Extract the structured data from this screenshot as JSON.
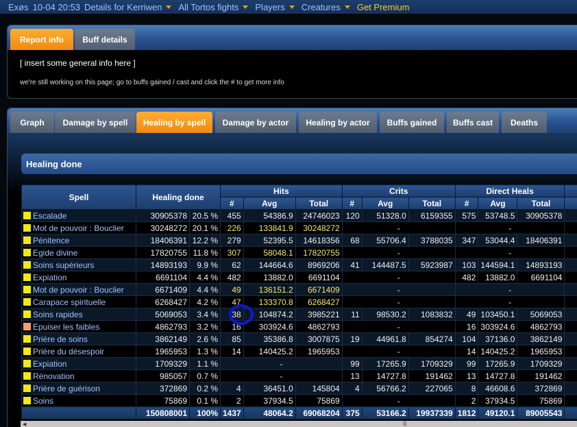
{
  "nav": {
    "items": [
      "Exøs",
      "10-04 20:53",
      "Details for Kerriwen",
      "All Tortos fights",
      "Players",
      "Creatures"
    ],
    "premium": "Get Premium"
  },
  "report_tabs": [
    "Report info",
    "Buff details"
  ],
  "report_info": {
    "text": "[ insert some general info here ]",
    "note": "we're still working on this page; go to buffs gained / cast and click the # to get more info"
  },
  "main_tabs": [
    "Graph",
    "Damage by spell",
    "Healing by spell",
    "Damage by actor",
    "Healing by actor",
    "Buffs gained",
    "Buffs cast",
    "Deaths"
  ],
  "active_tab": "Healing by spell",
  "section_title": "Healing done",
  "table": {
    "headers": {
      "spell": "Spell",
      "healing_done": "Healing done",
      "hits": "Hits",
      "crits": "Crits",
      "direct": "Direct Heals",
      "sub": [
        "#",
        "Avg",
        "Total",
        "#",
        "Avg",
        "Total",
        "#",
        "Avg",
        "Total"
      ]
    },
    "rows": [
      {
        "spell": "Escalade",
        "amount": "30905378",
        "pct": "20.5 %",
        "h_n": "455",
        "h_avg": "54386.9",
        "h_tot": "24746023",
        "c_n": "120",
        "c_avg": "51328.0",
        "c_tot": "6159355",
        "d_n": "575",
        "d_avg": "53748.5",
        "d_tot": "30905378"
      },
      {
        "spell": "Mot de pouvoir : Bouclier",
        "amount": "30248272",
        "pct": "20.1 %",
        "h_n": "226",
        "h_avg": "133841.9",
        "h_tot": "30248272",
        "c_dash": "-",
        "d_dash": "-"
      },
      {
        "spell": "Pénitence",
        "amount": "18406391",
        "pct": "12.2 %",
        "h_n": "279",
        "h_avg": "52395.5",
        "h_tot": "14618356",
        "c_n": "68",
        "c_avg": "55706.4",
        "c_tot": "3788035",
        "d_n": "347",
        "d_avg": "53044.4",
        "d_tot": "18406391"
      },
      {
        "spell": "Egide divine",
        "amount": "17820755",
        "pct": "11.8 %",
        "h_n": "307",
        "h_avg": "58048.1",
        "h_tot": "17820755",
        "c_dash": "-",
        "d_dash": "-"
      },
      {
        "spell": "Soins supérieurs",
        "amount": "14893193",
        "pct": "9.9 %",
        "h_n": "62",
        "h_avg": "144664.6",
        "h_tot": "8969206",
        "c_n": "41",
        "c_avg": "144487.5",
        "c_tot": "5923987",
        "d_n": "103",
        "d_avg": "144594.1",
        "d_tot": "14893193"
      },
      {
        "spell": "Expiation",
        "amount": "6691104",
        "pct": "4.4 %",
        "h_n": "482",
        "h_avg": "13882.0",
        "h_tot": "6691104",
        "c_dash": "-",
        "d_n": "482",
        "d_avg": "13882.0",
        "d_tot": "6691104"
      },
      {
        "spell": "Mot de pouvoir : Bouclier",
        "amount": "6671409",
        "pct": "4.4 %",
        "h_n": "49",
        "h_avg": "136151.2",
        "h_tot": "6671409",
        "c_dash": "-",
        "d_dash": "-"
      },
      {
        "spell": "Carapace spirituelle",
        "amount": "6268427",
        "pct": "4.2 %",
        "h_n": "47",
        "h_avg": "133370.8",
        "h_tot": "6268427",
        "c_dash": "-",
        "d_dash": "-"
      },
      {
        "spell": "Soins rapides",
        "amount": "5069053",
        "pct": "3.4 %",
        "h_n": "38",
        "h_avg": "104874.2",
        "h_tot": "3985221",
        "c_n": "11",
        "c_avg": "98530.2",
        "c_tot": "1083832",
        "d_n": "49",
        "d_avg": "103450.1",
        "d_tot": "5069053"
      },
      {
        "spell": "Epuiser les faibles",
        "amount": "4862793",
        "pct": "3.2 %",
        "h_n": "16",
        "h_avg": "303924.6",
        "h_tot": "4862793",
        "c_dash": "-",
        "d_n": "16",
        "d_avg": "303924.6",
        "d_tot": "4862793"
      },
      {
        "spell": "Prière de soins",
        "amount": "3862149",
        "pct": "2.6 %",
        "h_n": "85",
        "h_avg": "35386.8",
        "h_tot": "3007875",
        "c_n": "19",
        "c_avg": "44961.8",
        "c_tot": "854274",
        "d_n": "104",
        "d_avg": "37136.0",
        "d_tot": "3862149"
      },
      {
        "spell": "Prière du désespoir",
        "amount": "1965953",
        "pct": "1.3 %",
        "h_n": "14",
        "h_avg": "140425.2",
        "h_tot": "1965953",
        "c_dash": "-",
        "d_n": "14",
        "d_avg": "140425.2",
        "d_tot": "1965953"
      },
      {
        "spell": "Expiation",
        "amount": "1709329",
        "pct": "1.1 %",
        "h_dash": "-",
        "c_n": "99",
        "c_avg": "17265.9",
        "c_tot": "1709329",
        "d_n": "99",
        "d_avg": "17265.9",
        "d_tot": "1709329"
      },
      {
        "spell": "Rénovation",
        "amount": "985057",
        "pct": "0.7 %",
        "h_dash": "-",
        "c_n": "13",
        "c_avg": "14727.8",
        "c_tot": "191462",
        "d_n": "13",
        "d_avg": "14727.8",
        "d_tot": "191462"
      },
      {
        "spell": "Prière de guérison",
        "amount": "372869",
        "pct": "0.2 %",
        "h_n": "4",
        "h_avg": "36451.0",
        "h_tot": "145804",
        "c_n": "4",
        "c_avg": "56766.2",
        "c_tot": "227065",
        "d_n": "8",
        "d_avg": "46608.6",
        "d_tot": "372869"
      },
      {
        "spell": "Soins",
        "amount": "75869",
        "pct": "0.1 %",
        "h_n": "2",
        "h_avg": "37934.5",
        "h_tot": "75869",
        "c_dash": "-",
        "d_n": "2",
        "d_avg": "37934.5",
        "d_tot": "75869"
      }
    ],
    "total": {
      "amount": "150808001",
      "pct": "100%",
      "h_n": "1437",
      "h_avg": "48064.2",
      "h_tot": "69068204",
      "c_n": "375",
      "c_avg": "53166.2",
      "c_tot": "19937339",
      "d_n": "1812",
      "d_avg": "49120.1",
      "d_tot": "89005543"
    }
  },
  "colors": {
    "accent": "#f08a10",
    "swatch": "#f2e812",
    "link": "#9fc3ff"
  }
}
